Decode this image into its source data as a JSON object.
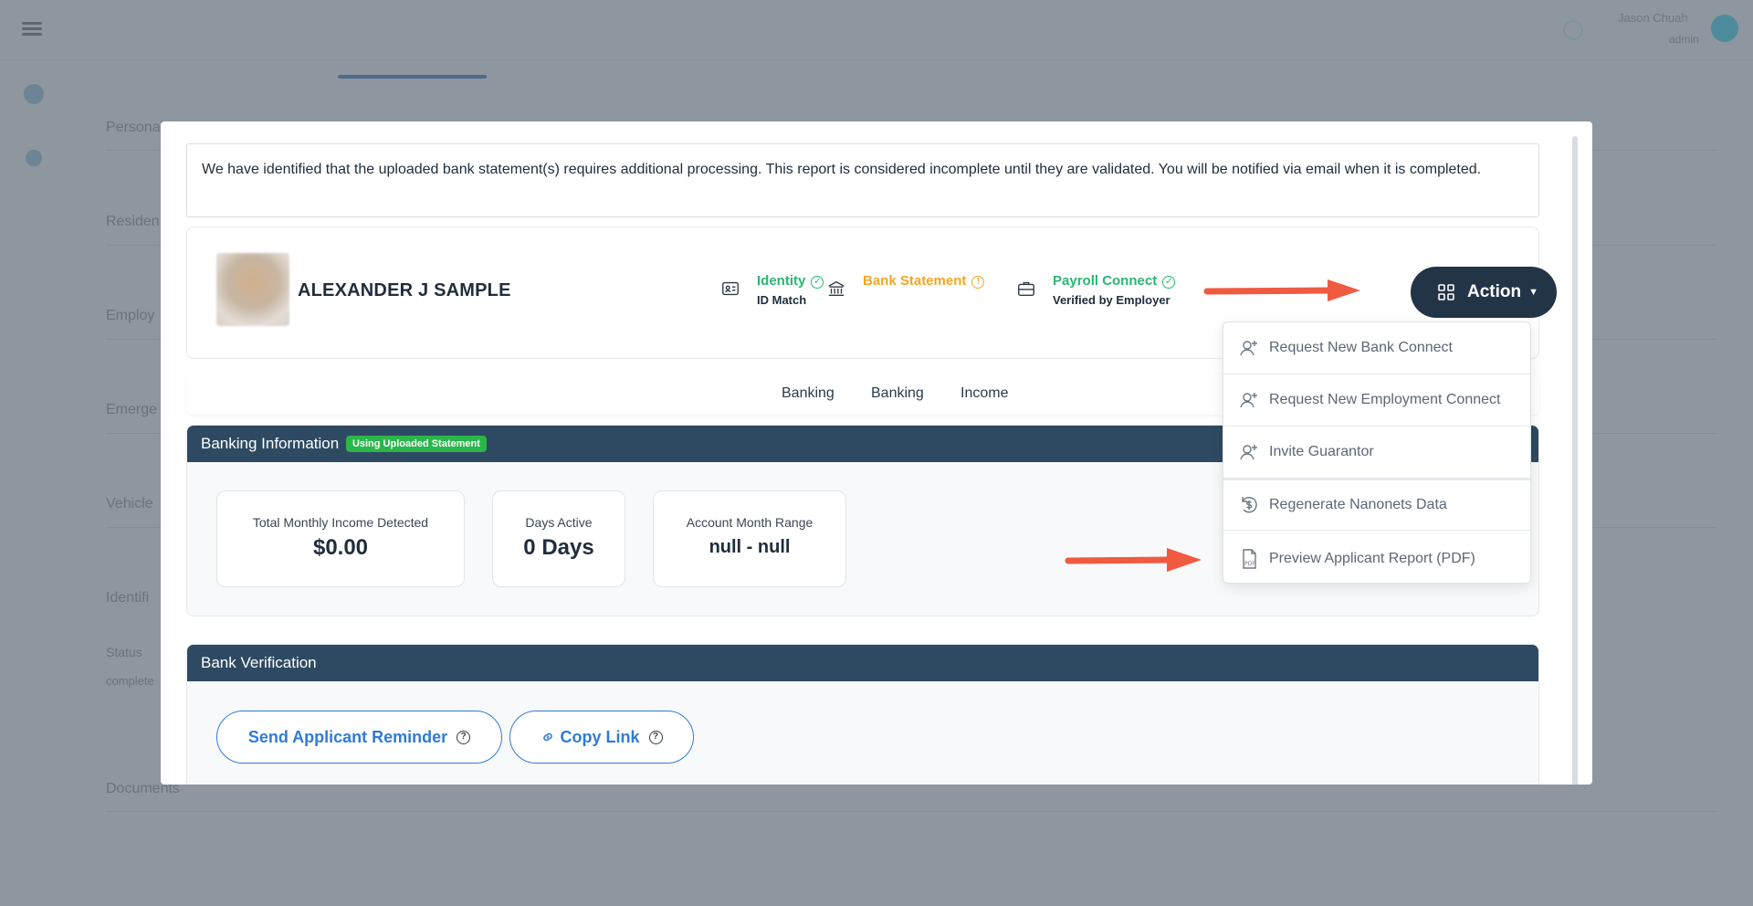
{
  "background": {
    "user_name": "Jason Chuah",
    "user_role": "admin",
    "rows": [
      "Personal",
      "Residen",
      "Employ",
      "Emerge",
      "Vehicle",
      "Identifi",
      "Documents"
    ],
    "status_label": "Status",
    "status_value": "complete"
  },
  "notice": {
    "text": "We have identified that the uploaded bank statement(s) requires additional processing. This report is considered incomplete until they are validated. You will be notified via email when it is completed."
  },
  "applicant": {
    "name": "ALEXANDER J SAMPLE"
  },
  "statuses": [
    {
      "title": "Identity",
      "subtitle": "ID Match",
      "state": "ok",
      "color": "#2bb673",
      "icon": "id-card-icon"
    },
    {
      "title": "Bank Statement",
      "subtitle": "",
      "state": "warning",
      "color": "#f5a623",
      "icon": "bank-icon"
    },
    {
      "title": "Payroll Connect",
      "subtitle": "Verified by Employer",
      "state": "ok",
      "color": "#2bb673",
      "icon": "briefcase-icon"
    }
  ],
  "action_button": {
    "label": "Action"
  },
  "dropdown": {
    "items": [
      {
        "label": "Request New Bank Connect",
        "icon": "user-plus-icon"
      },
      {
        "label": "Request New Employment Connect",
        "icon": "user-plus-icon"
      },
      {
        "label": "Invite Guarantor",
        "icon": "user-plus-icon"
      },
      {
        "label": "Regenerate Nanonets Data",
        "icon": "refresh-dollar-icon"
      },
      {
        "label": "Preview Applicant Report (PDF)",
        "icon": "pdf-icon"
      }
    ]
  },
  "tabs": [
    "Banking",
    "Banking",
    "Income"
  ],
  "banking": {
    "title": "Banking Information",
    "badge": "Using Uploaded Statement",
    "stats": [
      {
        "label": "Total Monthly Income Detected",
        "value": "$0.00"
      },
      {
        "label": "Days Active",
        "value": "0 Days"
      },
      {
        "label": "Account Month Range",
        "value": "null - null"
      }
    ]
  },
  "verification": {
    "title": "Bank Verification",
    "send_reminder_label": "Send Applicant Reminder",
    "copy_link_label": "Copy Link"
  },
  "colors": {
    "navy": "#233447",
    "header": "#2e4a62",
    "link_blue": "#2f7bd8",
    "green": "#2bb673",
    "orange": "#f5a623",
    "badge_green": "#2bb64a",
    "arrow_red": "#f05a40"
  }
}
